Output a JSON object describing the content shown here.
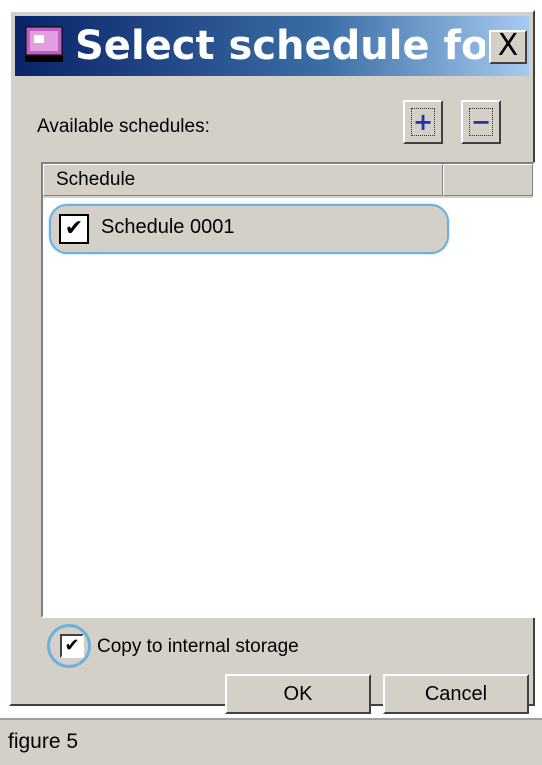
{
  "dialog": {
    "title": "Select schedule for ...",
    "close_label": "X",
    "available_label": "Available schedules:",
    "add_label": "+",
    "remove_label": "−"
  },
  "list": {
    "column_header": "Schedule",
    "rows": [
      {
        "label": "Schedule 0001",
        "checked": true,
        "check_mark": "✔"
      }
    ]
  },
  "copy_option": {
    "label": "Copy to internal storage",
    "checked": true,
    "check_mark": "✔"
  },
  "buttons": {
    "ok": "OK",
    "cancel": "Cancel"
  },
  "caption": "figure 5",
  "colors": {
    "title_gradient_start": "#0a246a",
    "title_gradient_end": "#a6caf0",
    "highlight": "#6ab0e0",
    "dialog_face": "#d4d0c8"
  },
  "icons": [
    "app-icon",
    "close-icon",
    "add-icon",
    "remove-icon",
    "checkbox-checked-icon"
  ]
}
